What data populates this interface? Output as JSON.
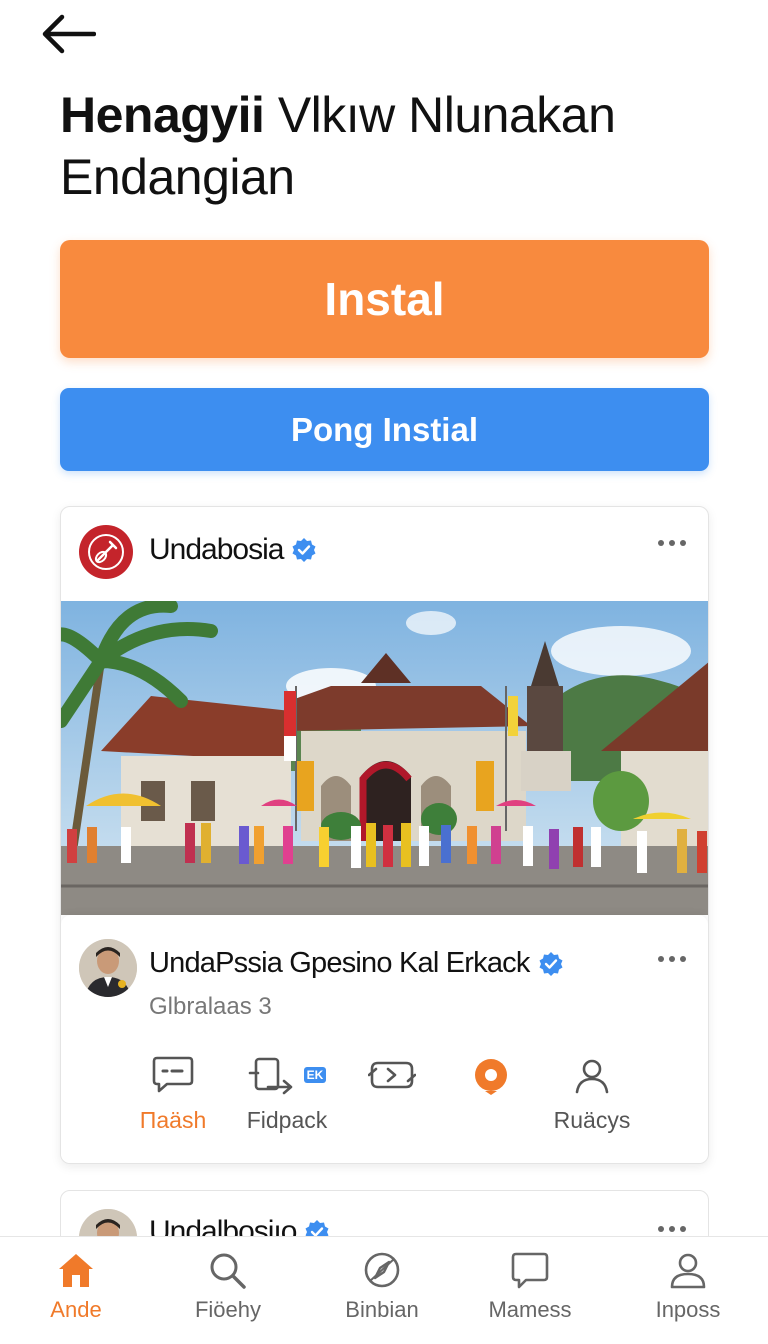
{
  "header": {
    "back_icon": "arrow-left-icon",
    "title_bold": "Henagyii",
    "title_rest": "Vlkıw Nlunakan Endangian"
  },
  "buttons": {
    "install_label": "Instal",
    "secondary_label": "Pong Instial",
    "install_color": "#f88a3e",
    "secondary_color": "#3d8ef0"
  },
  "post": {
    "account_name": "Undabosia",
    "verified_icon": "verified-badge-icon",
    "more_icon": "more-dots-icon",
    "image_alt": "village-temple-gathering-photo",
    "comment": {
      "name": "UndaPssia Gpesino Kal Erkack",
      "subtitle": "Glbralaas 3"
    },
    "actions": [
      {
        "label": "Πaäsh",
        "icon": "message-icon"
      },
      {
        "label": "Fidpack",
        "icon": "phone-forward-icon"
      },
      {
        "label": "",
        "icon": "swap-icon"
      },
      {
        "label": "",
        "icon": "record-icon"
      },
      {
        "label": "Ruäcys",
        "icon": "user-icon"
      }
    ],
    "small_badge": "EK"
  },
  "next_post": {
    "account_name": "Undalbosiıo"
  },
  "tabbar": {
    "items": [
      {
        "label": "Ande",
        "icon": "home-icon",
        "active": true
      },
      {
        "label": "Fiöehy",
        "icon": "search-icon"
      },
      {
        "label": "Binbian",
        "icon": "compass-icon"
      },
      {
        "label": "Mamess",
        "icon": "chat-icon"
      },
      {
        "label": "Inposs",
        "icon": "profile-icon"
      }
    ]
  },
  "colors": {
    "accent": "#f07a2a",
    "verified": "#3d8ef0"
  }
}
